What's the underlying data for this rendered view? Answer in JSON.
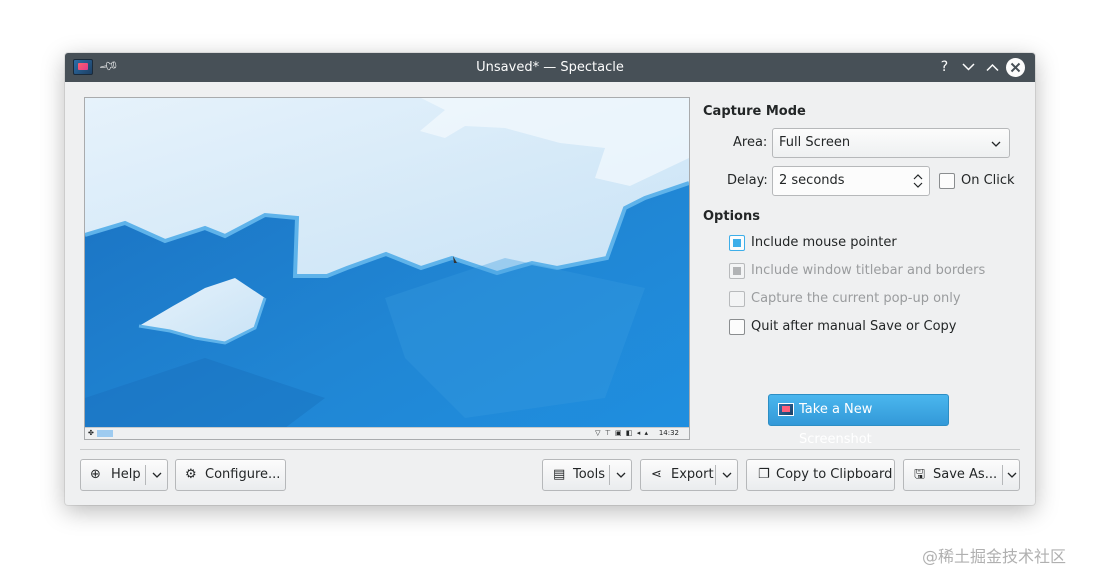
{
  "window": {
    "title": "Unsaved* — Spectacle",
    "help_icon": "?",
    "minimize_icon": "⌄",
    "maximize_icon": "⌃",
    "close_icon": "✕"
  },
  "preview": {
    "taskbar_clock": "14:32",
    "taskbar_tray": "▽ ⊤ ▣ ◧ ◂ ▴"
  },
  "capture_mode": {
    "heading": "Capture Mode",
    "area_label": "Area:",
    "area_value": "Full Screen",
    "delay_label": "Delay:",
    "delay_value": "2 seconds",
    "on_click_label": "On Click",
    "on_click_checked": false
  },
  "options": {
    "heading": "Options",
    "items": [
      {
        "label": "Include mouse pointer",
        "checked": true,
        "enabled": true
      },
      {
        "label": "Include window titlebar and borders",
        "checked": true,
        "enabled": false
      },
      {
        "label": "Capture the current pop-up only",
        "checked": false,
        "enabled": false
      },
      {
        "label": "Quit after manual Save or Copy",
        "checked": false,
        "enabled": true
      }
    ]
  },
  "take_screenshot_label": "Take a New Screenshot",
  "buttons": {
    "help": "Help",
    "configure": "Configure...",
    "tools": "Tools",
    "export": "Export",
    "copy": "Copy to Clipboard",
    "save_as": "Save As..."
  },
  "watermark": "@稀土掘金技术社区"
}
